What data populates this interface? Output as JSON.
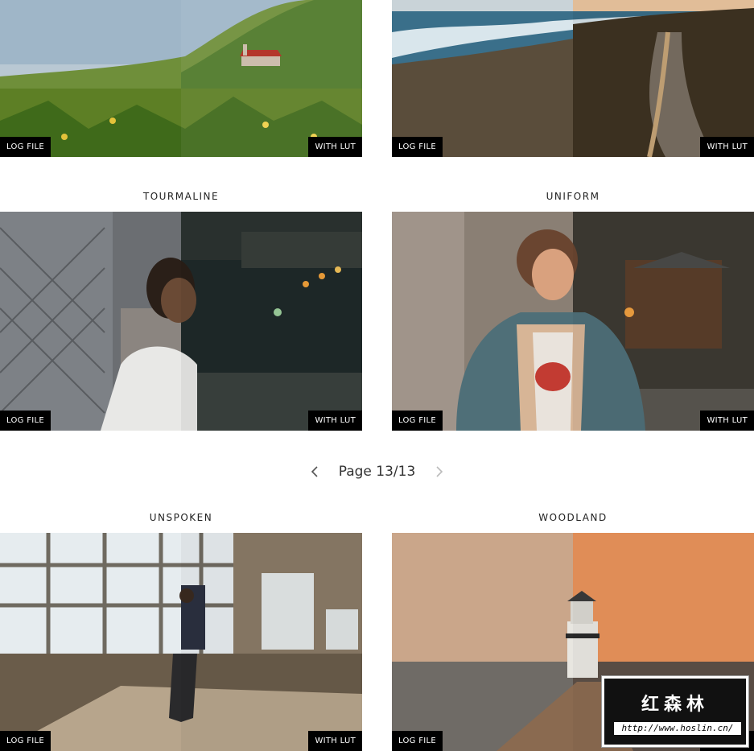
{
  "tags": {
    "before": "LOG FILE",
    "after": "WITH LUT"
  },
  "cards": [
    {
      "title": ""
    },
    {
      "title": ""
    },
    {
      "title": "TOURMALINE"
    },
    {
      "title": "UNIFORM"
    },
    {
      "title": "UNSPOKEN"
    },
    {
      "title": "WOODLAND"
    }
  ],
  "pagination": {
    "label": "Page 13/13"
  },
  "watermark": {
    "text": "红森林",
    "url": "http://www.hoslin.cn/"
  }
}
